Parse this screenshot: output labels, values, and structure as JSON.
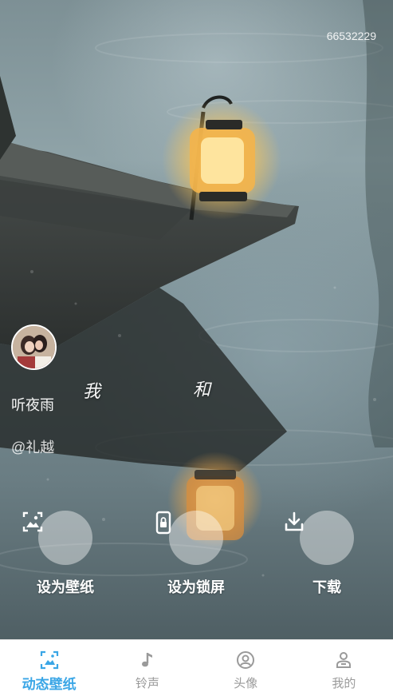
{
  "wallpaper": {
    "id_number": "66532229",
    "lyrics": [
      "我",
      "和"
    ]
  },
  "author": {
    "song_title": "听夜雨",
    "handle": "@礼越"
  },
  "actions": [
    {
      "label": "设为壁纸",
      "icon": "image-icon"
    },
    {
      "label": "设为锁屏",
      "icon": "lock-phone-icon"
    },
    {
      "label": "下载",
      "icon": "download-icon"
    }
  ],
  "nav": [
    {
      "label": "动态壁纸",
      "icon": "wallpaper-icon",
      "active": true
    },
    {
      "label": "铃声",
      "icon": "music-note-icon",
      "active": false
    },
    {
      "label": "头像",
      "icon": "avatar-circle-icon",
      "active": false
    },
    {
      "label": "我的",
      "icon": "person-icon",
      "active": false
    }
  ],
  "colors": {
    "accent": "#3aa6e6",
    "nav_inactive": "#9a9a9a",
    "lantern_glow": "#f6c45a"
  }
}
